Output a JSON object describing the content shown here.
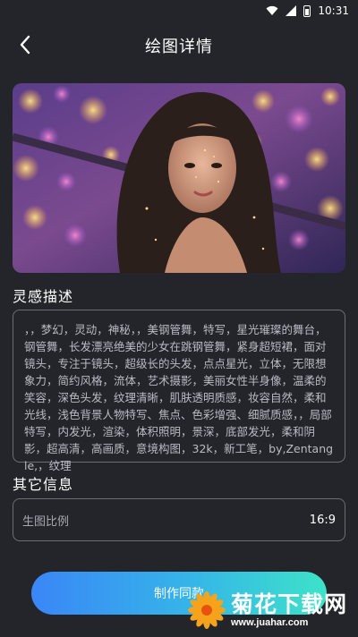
{
  "status_bar": {
    "time": "10:31",
    "icons": [
      "wifi-icon",
      "signal-icon",
      "battery-icon"
    ]
  },
  "header": {
    "back_icon": "chevron-left-icon",
    "title": "绘图详情"
  },
  "hero_image": {
    "subject": "portrait-with-bokeh-lights"
  },
  "inspiration": {
    "label": "灵感描述",
    "text": "，，梦幻，灵动，神秘，，美钢管舞，特写，星光璀璨的舞台，钢管舞，长发漂亮绝美的少女在跳钢管舞，紧身超短裙，面对镜头，专注于镜头，超级长的头发，点点星光，立体，无限想象力，简约风格，流体，艺术摄影，美丽女性半身像，温柔的笑容，深色头发，纹理清晰，肌肤透明质感，妆容自然，柔和光线，浅色背景人物特写、焦点、色彩增强、细腻质感，，局部特写，内发光，渲染，体积照明，景深，底部发光，柔和阴影，超高清，高画质，意境构图，32k，新工笔，by,Zentangle,，纹理"
  },
  "other_info": {
    "label": "其它信息",
    "ratio_label": "生图比例",
    "ratio_value": "16:9"
  },
  "action": {
    "make_same_label": "制作同款"
  },
  "watermark": {
    "title": "菊花下载网",
    "url": "www.juahar.com",
    "icon": "chrysanthemum-logo-icon"
  },
  "colors": {
    "background": "#23252b",
    "border": "#6b6e76",
    "button_gradient_start": "#3a86f7",
    "button_gradient_end": "#3de3c8"
  }
}
